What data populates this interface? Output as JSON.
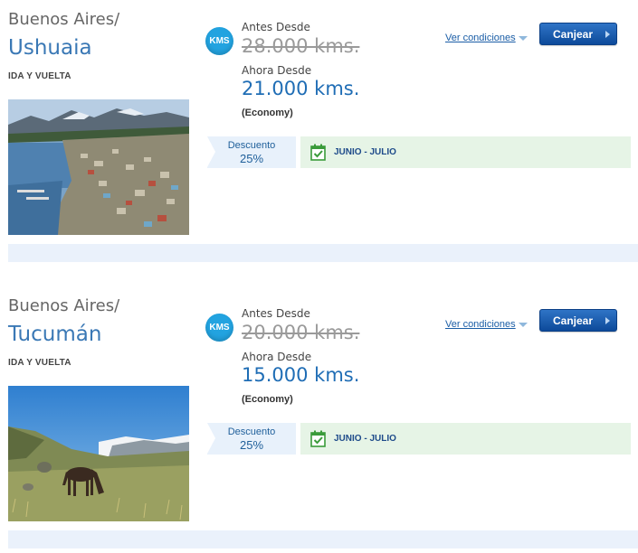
{
  "offers": [
    {
      "origin": "Buenos Aires/",
      "destination": "Ushuaia",
      "trip_type": "IDA Y VUELTA",
      "badge": "KMS",
      "before_label": "Antes Desde",
      "before_value": "28.000 kms.",
      "now_label": "Ahora Desde",
      "now_value": "21.000 kms.",
      "cabin": "(Economy)",
      "conditions_label": "Ver condiciones",
      "redeem_label": "Canjear",
      "discount_label": "Descuento",
      "discount_value": "25%",
      "period": "JUNIO - JULIO",
      "image": "ushuaia-city-photo"
    },
    {
      "origin": "Buenos Aires/",
      "destination": "Tucumán",
      "trip_type": "IDA Y VUELTA",
      "badge": "KMS",
      "before_label": "Antes Desde",
      "before_value": "20.000 kms.",
      "now_label": "Ahora Desde",
      "now_value": "15.000 kms.",
      "cabin": "(Economy)",
      "conditions_label": "Ver condiciones",
      "redeem_label": "Canjear",
      "discount_label": "Descuento",
      "discount_value": "25%",
      "period": "JUNIO - JULIO",
      "image": "tucuman-horse-landscape-photo"
    }
  ],
  "colors": {
    "link": "#1a5da6",
    "price_now": "#1f6db5",
    "destination": "#3a78b5",
    "badge": "#22a3e0",
    "button": "#0d4a9a",
    "discount_bg": "#e8f1fb",
    "period_bg": "#e6f4e6",
    "separator": "#eaf1fb"
  }
}
